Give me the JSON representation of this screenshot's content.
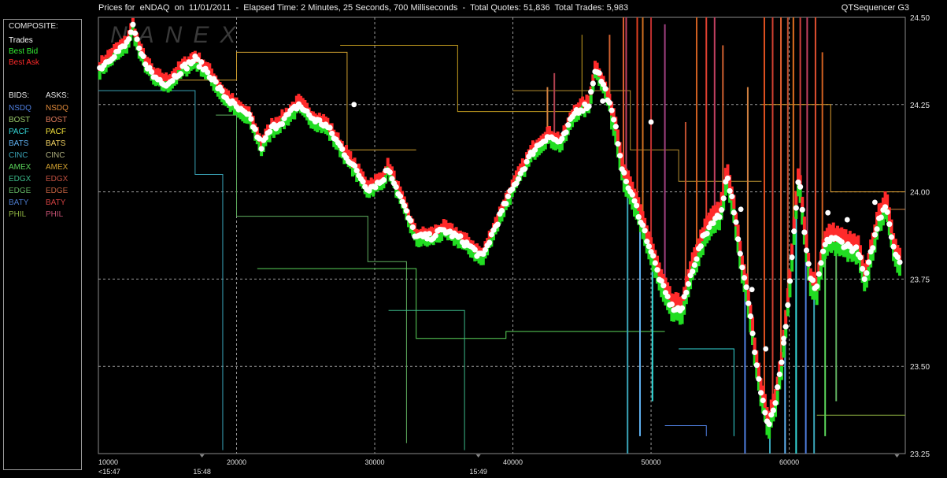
{
  "header": {
    "prices_for_label": "Prices for  eNDAQ  on  11/01/2011",
    "elapsed_label": "Elapsed Time: 2 Minutes, 25 Seconds, 700 Milliseconds",
    "quotes_label": "Total Quotes: 51,836",
    "trades_label": "Total Trades: 5,983",
    "separator": "-",
    "app_name": "QTSequencer G3"
  },
  "watermark": "NANEX",
  "legend": {
    "composite_title": "COMPOSITE:",
    "composite": [
      {
        "label": "Trades",
        "color": "#ffffff"
      },
      {
        "label": "Best Bid",
        "color": "#33ee33"
      },
      {
        "label": "Best Ask",
        "color": "#ff2a2a"
      }
    ],
    "bids_title": "BIDS:",
    "asks_title": "ASKS:",
    "exchanges": [
      {
        "bid": "NSDQ",
        "ask": "NSDQ",
        "bid_color": "#4f7fe0",
        "ask_color": "#e08a3a"
      },
      {
        "bid": "BOST",
        "ask": "BOST",
        "bid_color": "#9acb6a",
        "ask_color": "#e07a5a"
      },
      {
        "bid": "PACF",
        "ask": "PACF",
        "bid_color": "#34d9d9",
        "ask_color": "#f2e23a"
      },
      {
        "bid": "BATS",
        "ask": "BATS",
        "bid_color": "#5fb0f0",
        "ask_color": "#f0d060"
      },
      {
        "bid": "CINC",
        "ask": "CINC",
        "bid_color": "#3aa4b8",
        "ask_color": "#b0b080"
      },
      {
        "bid": "AMEX",
        "ask": "AMEX",
        "bid_color": "#5ad45a",
        "ask_color": "#d0a030"
      },
      {
        "bid": "EDGX",
        "ask": "EDGX",
        "bid_color": "#3ab888",
        "ask_color": "#c05040"
      },
      {
        "bid": "EDGE",
        "ask": "EDGE",
        "bid_color": "#60b060",
        "ask_color": "#c06040"
      },
      {
        "bid": "BATY",
        "ask": "BATY",
        "bid_color": "#4a78c8",
        "ask_color": "#d04040"
      },
      {
        "bid": "PHIL",
        "ask": "PHIL",
        "bid_color": "#8cb040",
        "ask_color": "#c05070"
      }
    ]
  },
  "chart_data": {
    "type": "scatter",
    "title": "",
    "xlabel": "",
    "ylabel": "",
    "x_ticks": [
      10000,
      20000,
      30000,
      40000,
      50000,
      60000
    ],
    "x_time_ticks": [
      {
        "x": 10000,
        "label": "<15:47"
      },
      {
        "x": 17500,
        "label": "15:48"
      },
      {
        "x": 37500,
        "label": "15:49"
      }
    ],
    "xlim": [
      10000,
      68400
    ],
    "y_ticks": [
      "23.25",
      "23.50",
      "23.75",
      "24.00",
      "24.25",
      "24.50"
    ],
    "ylim": [
      23.25,
      24.5
    ],
    "grid": true,
    "trades_path": [
      [
        10000,
        24.35
      ],
      [
        11000,
        24.39
      ],
      [
        12000,
        24.42
      ],
      [
        12500,
        24.47
      ],
      [
        13000,
        24.4
      ],
      [
        14000,
        24.33
      ],
      [
        15000,
        24.31
      ],
      [
        16000,
        24.35
      ],
      [
        17000,
        24.38
      ],
      [
        18000,
        24.34
      ],
      [
        19000,
        24.28
      ],
      [
        20000,
        24.24
      ],
      [
        21000,
        24.21
      ],
      [
        21800,
        24.13
      ],
      [
        22500,
        24.18
      ],
      [
        23500,
        24.21
      ],
      [
        24500,
        24.25
      ],
      [
        25500,
        24.21
      ],
      [
        26500,
        24.19
      ],
      [
        27500,
        24.13
      ],
      [
        28500,
        24.07
      ],
      [
        29500,
        24.01
      ],
      [
        30500,
        24.03
      ],
      [
        31000,
        24.07
      ],
      [
        32000,
        23.97
      ],
      [
        33000,
        23.87
      ],
      [
        34000,
        23.87
      ],
      [
        35000,
        23.89
      ],
      [
        36000,
        23.87
      ],
      [
        37000,
        23.84
      ],
      [
        37800,
        23.81
      ],
      [
        38500,
        23.88
      ],
      [
        39500,
        23.97
      ],
      [
        40500,
        24.05
      ],
      [
        41500,
        24.12
      ],
      [
        42500,
        24.16
      ],
      [
        43500,
        24.14
      ],
      [
        44500,
        24.23
      ],
      [
        45500,
        24.25
      ],
      [
        46000,
        24.36
      ],
      [
        46800,
        24.28
      ],
      [
        47500,
        24.17
      ],
      [
        48000,
        24.05
      ],
      [
        49000,
        23.95
      ],
      [
        50000,
        23.83
      ],
      [
        50800,
        23.73
      ],
      [
        51500,
        23.67
      ],
      [
        52200,
        23.66
      ],
      [
        53000,
        23.78
      ],
      [
        53800,
        23.87
      ],
      [
        54500,
        23.92
      ],
      [
        55000,
        23.93
      ],
      [
        55500,
        24.05
      ],
      [
        56000,
        23.95
      ],
      [
        56500,
        23.8
      ],
      [
        57000,
        23.7
      ],
      [
        57500,
        23.55
      ],
      [
        58000,
        23.42
      ],
      [
        58500,
        23.33
      ],
      [
        59000,
        23.4
      ],
      [
        59500,
        23.52
      ],
      [
        60000,
        23.72
      ],
      [
        60700,
        24.05
      ],
      [
        61000,
        23.92
      ],
      [
        61500,
        23.75
      ],
      [
        62000,
        23.72
      ],
      [
        62500,
        23.84
      ],
      [
        63000,
        23.87
      ],
      [
        64000,
        23.85
      ],
      [
        65000,
        23.83
      ],
      [
        65500,
        23.74
      ],
      [
        66000,
        23.84
      ],
      [
        66500,
        23.92
      ],
      [
        67000,
        23.97
      ],
      [
        67500,
        23.85
      ],
      [
        68000,
        23.8
      ]
    ],
    "bid_steps": [
      [
        [
          10000,
          24.29
        ],
        [
          17000,
          24.29
        ],
        [
          17000,
          24.05
        ],
        [
          19000,
          24.05
        ],
        [
          19000,
          23.26
        ]
      ],
      [
        [
          18500,
          24.22
        ],
        [
          20000,
          24.22
        ],
        [
          20000,
          23.93
        ],
        [
          29500,
          23.93
        ],
        [
          29500,
          23.8
        ],
        [
          32300,
          23.8
        ],
        [
          32300,
          23.28
        ]
      ],
      [
        [
          21500,
          23.78
        ],
        [
          33000,
          23.78
        ],
        [
          33000,
          23.58
        ],
        [
          39500,
          23.58
        ],
        [
          39500,
          23.6
        ],
        [
          51000,
          23.6
        ]
      ],
      [
        [
          31000,
          23.66
        ],
        [
          36500,
          23.66
        ],
        [
          36500,
          23.26
        ]
      ],
      [
        [
          52000,
          23.55
        ],
        [
          56000,
          23.55
        ],
        [
          56000,
          23.3
        ]
      ],
      [
        [
          51000,
          23.33
        ],
        [
          54000,
          23.33
        ],
        [
          54000,
          23.3
        ]
      ],
      [
        [
          62000,
          23.36
        ],
        [
          68400,
          23.36
        ]
      ]
    ],
    "ask_steps": [
      [
        [
          14000,
          24.32
        ],
        [
          20000,
          24.32
        ],
        [
          20000,
          24.4
        ],
        [
          28000,
          24.4
        ],
        [
          28000,
          24.12
        ],
        [
          33000,
          24.12
        ]
      ],
      [
        [
          27500,
          24.42
        ],
        [
          36000,
          24.42
        ],
        [
          36000,
          24.23
        ],
        [
          45000,
          24.23
        ],
        [
          45000,
          24.45
        ]
      ],
      [
        [
          40000,
          24.29
        ],
        [
          48500,
          24.29
        ],
        [
          48500,
          24.12
        ],
        [
          52000,
          24.12
        ],
        [
          52000,
          24.03
        ],
        [
          58000,
          24.03
        ]
      ],
      [
        [
          58000,
          24.25
        ],
        [
          63000,
          24.25
        ],
        [
          63000,
          24.0
        ],
        [
          68400,
          24.0
        ]
      ],
      [
        [
          66500,
          23.95
        ],
        [
          68400,
          23.95
        ]
      ]
    ],
    "ask_spikes": [
      {
        "x": 42500,
        "to": 24.3,
        "color": "#d08040"
      },
      {
        "x": 43000,
        "to": 24.34,
        "color": "#b04050"
      },
      {
        "x": 47000,
        "to": 24.45,
        "color": "#d06030"
      },
      {
        "x": 48000,
        "to": 24.5,
        "color": "#e06030"
      },
      {
        "x": 48200,
        "to": 24.5,
        "color": "#c04060"
      },
      {
        "x": 49000,
        "to": 24.5,
        "color": "#e04020"
      },
      {
        "x": 49400,
        "to": 24.5,
        "color": "#d07020"
      },
      {
        "x": 50000,
        "to": 24.5,
        "color": "#c03030"
      },
      {
        "x": 51000,
        "to": 24.48,
        "color": "#a04080"
      },
      {
        "x": 52500,
        "to": 24.2,
        "color": "#c05030"
      },
      {
        "x": 53300,
        "to": 24.5,
        "color": "#d06020"
      },
      {
        "x": 54000,
        "to": 24.5,
        "color": "#e04030"
      },
      {
        "x": 54600,
        "to": 24.5,
        "color": "#c04060"
      },
      {
        "x": 55200,
        "to": 24.42,
        "color": "#d06030"
      },
      {
        "x": 57000,
        "to": 24.3,
        "color": "#d08040"
      },
      {
        "x": 58200,
        "to": 24.5,
        "color": "#e05020"
      },
      {
        "x": 58800,
        "to": 24.5,
        "color": "#d04030"
      },
      {
        "x": 59400,
        "to": 24.5,
        "color": "#e06030"
      },
      {
        "x": 59900,
        "to": 24.5,
        "color": "#c05030"
      },
      {
        "x": 60300,
        "to": 24.5,
        "color": "#e07020"
      },
      {
        "x": 60800,
        "to": 24.5,
        "color": "#d04040"
      },
      {
        "x": 61300,
        "to": 24.5,
        "color": "#c04060"
      },
      {
        "x": 61900,
        "to": 24.5,
        "color": "#e05030"
      },
      {
        "x": 62400,
        "to": 24.4,
        "color": "#d06020"
      }
    ],
    "bid_spikes": [
      {
        "x": 48300,
        "to": 23.25,
        "color": "#3aa4b8"
      },
      {
        "x": 49200,
        "to": 23.3,
        "color": "#5fb0f0"
      },
      {
        "x": 50100,
        "to": 23.4,
        "color": "#34d9d9"
      },
      {
        "x": 56800,
        "to": 23.25,
        "color": "#4f7fe0"
      },
      {
        "x": 58600,
        "to": 23.25,
        "color": "#3aa4b8"
      },
      {
        "x": 59700,
        "to": 23.25,
        "color": "#5fb0f0"
      },
      {
        "x": 60500,
        "to": 23.25,
        "color": "#34d9d9"
      },
      {
        "x": 61200,
        "to": 23.25,
        "color": "#4f7fe0"
      },
      {
        "x": 61800,
        "to": 23.25,
        "color": "#3aa4b8"
      },
      {
        "x": 62600,
        "to": 23.3,
        "color": "#5ad45a"
      },
      {
        "x": 63400,
        "to": 23.4,
        "color": "#60b060"
      }
    ],
    "outlier_trades": [
      [
        28500,
        24.25
      ],
      [
        46500,
        24.26
      ],
      [
        50000,
        24.2
      ],
      [
        56500,
        23.95
      ],
      [
        57300,
        23.72
      ],
      [
        58300,
        23.55
      ],
      [
        59600,
        23.58
      ],
      [
        64200,
        23.92
      ],
      [
        62800,
        23.94
      ],
      [
        66200,
        23.97
      ]
    ]
  }
}
